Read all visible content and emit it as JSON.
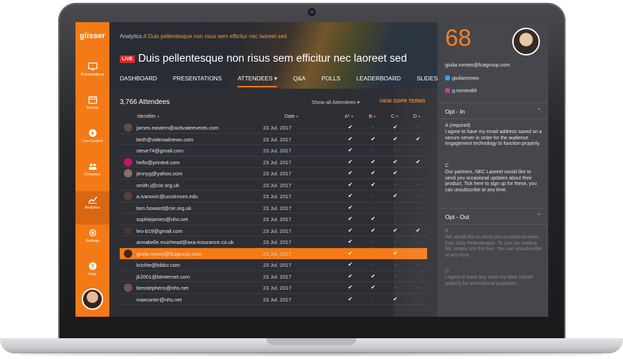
{
  "app": {
    "logo": "glisser"
  },
  "sidebar": {
    "items": [
      {
        "label": "Presentations",
        "icon": "monitor-icon"
      },
      {
        "label": "Events",
        "icon": "calendar-icon"
      },
      {
        "label": "Live Control",
        "icon": "play-icon"
      },
      {
        "label": "Company",
        "icon": "people-icon"
      },
      {
        "label": "Analytics",
        "icon": "chart-icon",
        "active": true
      },
      {
        "label": "Settings",
        "icon": "gear-icon"
      },
      {
        "label": "Help",
        "icon": "help-icon"
      }
    ]
  },
  "header": {
    "breadcrumb_root": "Analytics //",
    "breadcrumb_current": "Duis pellentesque non risus sem efficitur nec laoreet sed",
    "live_badge": "LIVE",
    "title": "Duis pellentesque non risus sem efficitur nec laoreet sed",
    "tabs": [
      "DASHBOARD",
      "PRESENTATIONS",
      "ATTENDEES ▾",
      "Q&A",
      "POLLS",
      "LEADERBOARD",
      "SLIDES"
    ],
    "active_tab": "ATTENDEES"
  },
  "list": {
    "count_label": "3,766 Attendees",
    "filter_label": "Show all Attendees ▾",
    "gdpr_link": "VIEW GDPR TERMS",
    "columns": {
      "identifier": "Identifier",
      "date": "Date",
      "a": "A*",
      "b": "B",
      "c": "C",
      "d": "D"
    },
    "rows": [
      {
        "id": "james.eastern@activateevents.com",
        "date": "23 Jul. 2017",
        "a": "✔",
        "b": "-",
        "c": "✔",
        "d": "-"
      },
      {
        "id": "beth@videoadnews.com",
        "date": "23 Jul. 2017",
        "a": "✔",
        "b": "✔",
        "c": "✔",
        "d": "✔"
      },
      {
        "id": "steve74@gmail.com",
        "date": "23 Jul. 2017",
        "a": "✔",
        "b": "-",
        "c": "-",
        "d": "-"
      },
      {
        "id": "hello@printed.com",
        "date": "23 Jul. 2017",
        "a": "✔",
        "b": "✔",
        "c": "✔",
        "d": "✔"
      },
      {
        "id": "jennyg@yahoo.com",
        "date": "23 Jul. 2017",
        "a": "✔",
        "b": "✔",
        "c": "✔",
        "d": "-"
      },
      {
        "id": "smith.j@cie.org.uk",
        "date": "23 Jul. 2017",
        "a": "✔",
        "b": "✔",
        "c": "-",
        "d": "-"
      },
      {
        "id": "a.ivanovic@usciences.edu",
        "date": "23 Jul. 2017",
        "a": "✔",
        "b": "-",
        "c": "✔",
        "d": "-"
      },
      {
        "id": "ben.howard@cie.org.uk",
        "date": "23 Jul. 2017",
        "a": "✔",
        "b": "-",
        "c": "-",
        "d": "-"
      },
      {
        "id": "sophiejames@nhs.net",
        "date": "23 Jul. 2017",
        "a": "✔",
        "b": "✔",
        "c": "-",
        "d": "-"
      },
      {
        "id": "leo-b19@gmail.com",
        "date": "23 Jul. 2017",
        "a": "✔",
        "b": "✔",
        "c": "✔",
        "d": "✔"
      },
      {
        "id": "annabelle.muirhead@axa-insurance.co.uk",
        "date": "23 Jul. 2017",
        "a": "✔",
        "b": "-",
        "c": "-",
        "d": "-"
      },
      {
        "id": "giulia.romeo@fcagroup.com",
        "date": "23 Jul. 2017",
        "a": "✔",
        "b": "-",
        "c": "✔",
        "d": "-",
        "selected": true
      },
      {
        "id": "krichie@bildcr.com",
        "date": "23 Jul. 2017",
        "a": "✔",
        "b": "-",
        "c": "-",
        "d": "-"
      },
      {
        "id": "jk2001@btinternet.com",
        "date": "23 Jul. 2017",
        "a": "✔",
        "b": "✔",
        "c": "-",
        "d": "-"
      },
      {
        "id": "benstephens@nhs.net",
        "date": "23 Jul. 2017",
        "a": "✔",
        "b": "✔",
        "c": "-",
        "d": "-"
      },
      {
        "id": "maxcarter@nhs.net",
        "date": "23 Jul. 2017",
        "a": "✔",
        "b": "-",
        "c": "✔",
        "d": "-"
      }
    ]
  },
  "profile": {
    "score": "68",
    "email": "giulia.romeo@fcagroup.com",
    "twitter": "giuliaromeo",
    "instagram": "g.romeo89",
    "opt_in": {
      "heading": "Opt - In",
      "a_title": "A (required)",
      "a_text": "I agree to have my email address saved on a secure server in order for the audience engagement technology to function properly.",
      "c_title": "C",
      "c_text": "Our partners, NEC Laoreet would like to send you occasional updates about their product. Tick here to sign up for these, you can unsubscribe at any time."
    },
    "opt_out": {
      "heading": "Opt - Out",
      "b_title": "B",
      "b_text": "We would like to send you occasional news from Duis Pellentesque. To join our mailing list, simply tick this box. You can unsubscribe at any time.",
      "d_title": "D",
      "d_text": "I agree to have any have my data shared publicly for promotional purposes."
    }
  },
  "colors": {
    "accent": "#f47a17",
    "panel": "#3a3c41",
    "screen_bg": "#2d2f34",
    "live": "#e0262b"
  }
}
